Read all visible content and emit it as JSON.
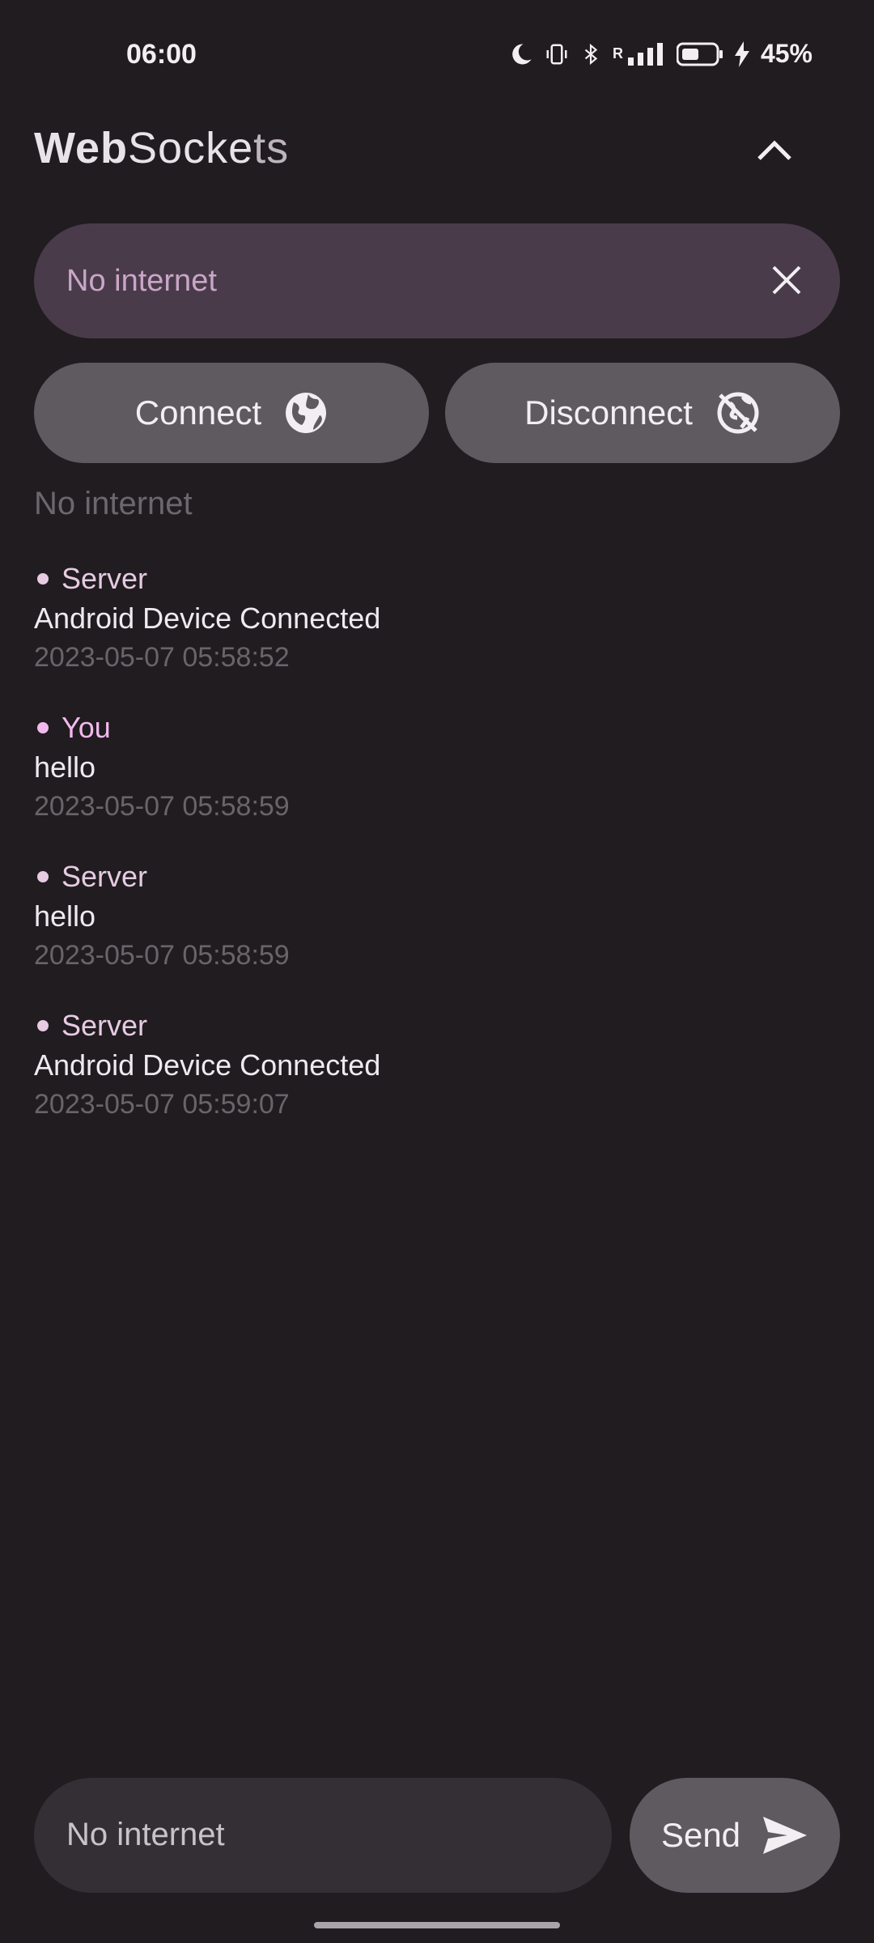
{
  "status_bar": {
    "time": "06:00",
    "battery": "45%",
    "network_label": "R"
  },
  "app": {
    "title_part1": "Web",
    "title_part2": "Socke",
    "title_part3": "ts"
  },
  "url_field": {
    "value": "No internet"
  },
  "buttons": {
    "connect": "Connect",
    "disconnect": "Disconnect",
    "send": "Send"
  },
  "connection_status": "No internet",
  "messages": [
    {
      "sender": "Server",
      "text": "Android Device Connected",
      "time": "2023-05-07 05:58:52"
    },
    {
      "sender": "You",
      "text": "hello",
      "time": "2023-05-07 05:58:59"
    },
    {
      "sender": "Server",
      "text": "hello",
      "time": "2023-05-07 05:58:59"
    },
    {
      "sender": "Server",
      "text": "Android Device Connected",
      "time": "2023-05-07 05:59:07"
    }
  ],
  "message_input": {
    "value": "No internet"
  },
  "colors": {
    "background": "#201c20",
    "accent": "#f2b9ee",
    "field": "#4a3b4b",
    "button": "#5f5a5f"
  },
  "icons": [
    "moon-icon",
    "vibrate-icon",
    "bluetooth-icon",
    "signal-icon",
    "battery-icon",
    "charging-icon",
    "chevron-up-icon",
    "close-icon",
    "globe-icon",
    "globe-off-icon",
    "send-icon"
  ]
}
